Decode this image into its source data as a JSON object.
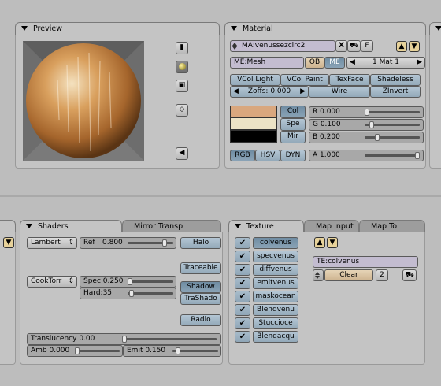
{
  "preview": {
    "title": "Preview"
  },
  "material": {
    "title": "Material",
    "ma_name": "MA:venussezcirc2",
    "x_label": "X",
    "f_label": "F",
    "me_name": "ME:Mesh",
    "ob_label": "OB",
    "me_label": "ME",
    "mat_count": "1 Mat 1",
    "vcol_light": "VCol Light",
    "vcol_paint": "VCol Paint",
    "texface": "TexFace",
    "shadeless": "Shadeless",
    "zoffs": "Zoffs: 0.000",
    "wire": "Wire",
    "zinvert": "ZInvert",
    "col": "Col",
    "spe": "Spe",
    "mir": "Mir",
    "r": "R 0.000",
    "r_value": 0.0,
    "g": "G 0.100",
    "g_value": 0.1,
    "b": "B 0.200",
    "b_value": 0.2,
    "rgb": "RGB",
    "hsv": "HSV",
    "dyn": "DYN",
    "a": "A 1.000",
    "a_value": 1.0
  },
  "shaders": {
    "tab_shaders": "Shaders",
    "tab_mirror": "Mirror Transp",
    "diffuse_shader": "Lambert",
    "ref": "Ref",
    "ref_value": "0.800",
    "halo": "Halo",
    "traceable": "Traceable",
    "spec_shader": "CookTorr",
    "spec": "Spec 0.250",
    "hard": "Hard:35",
    "shadow": "Shadow",
    "trashado": "TraShado",
    "radio": "Radio",
    "translucency": "Translucency 0.00",
    "amb": "Amb 0.000",
    "emit": "Emit 0.150"
  },
  "texture": {
    "tab_texture": "Texture",
    "tab_mapinput": "Map Input",
    "tab_mapto": "Map To",
    "channels": [
      "colvenus",
      "specvenus",
      "diffvenus",
      "emitvenus",
      "maskocean",
      "Blendvenu",
      "Stuccioce",
      "Blendacqu"
    ],
    "te_name": "TE:colvenus",
    "clear": "Clear",
    "users": "2"
  },
  "colors": {
    "col_swatch": "#d9a77e",
    "spe_swatch": "#ece3c6",
    "mir_swatch": "#000000"
  }
}
